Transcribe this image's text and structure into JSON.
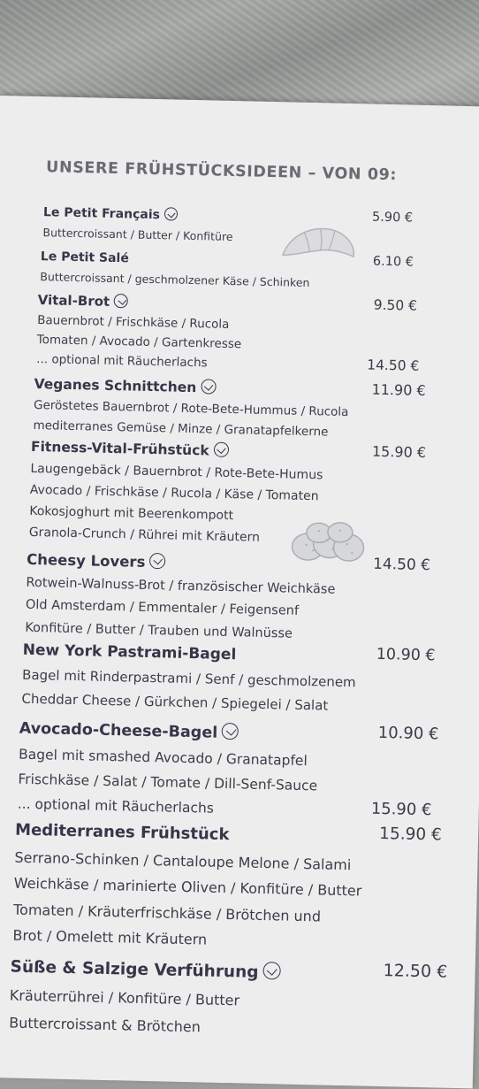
{
  "header": "UNSERE FRÜHSTÜCKSIDEEN – VON 09:",
  "items": [
    {
      "name": "Le Petit Français",
      "vegan_icon": true,
      "price": "5.90 €",
      "lines": [
        "Buttercroissant / Butter / Konfitüre"
      ]
    },
    {
      "name": "Le Petit Salé",
      "vegan_icon": false,
      "price": "6.10 €",
      "lines": [
        "Buttercroissant / geschmolzener Käse / Schinken"
      ]
    },
    {
      "name": "Vital-Brot",
      "vegan_icon": true,
      "price": "9.50 €",
      "lines": [
        "Bauernbrot / Frischkäse / Rucola",
        "Tomaten / Avocado / Gartenkresse",
        "... optional mit Räucherlachs"
      ],
      "extra_price": "14.50 €"
    },
    {
      "name": "Veganes Schnittchen",
      "vegan_icon": true,
      "price": "11.90 €",
      "lines": [
        "Geröstetes Bauernbrot / Rote-Bete-Hummus / Rucola",
        "mediterranes Gemüse / Minze / Granatapfelkerne"
      ]
    },
    {
      "name": "Fitness-Vital-Frühstück",
      "vegan_icon": true,
      "price": "15.90 €",
      "lines": [
        "Laugengebäck / Bauernbrot / Rote-Bete-Humus",
        "Avocado / Frischkäse / Rucola / Käse / Tomaten",
        "Kokosjoghurt mit Beerenkompott",
        "Granola-Crunch / Rührei mit Kräutern"
      ]
    },
    {
      "name": "Cheesy Lovers",
      "vegan_icon": true,
      "price": "14.50 €",
      "lines": [
        "Rotwein-Walnuss-Brot / französischer Weichkäse",
        "Old Amsterdam  / Emmentaler / Feigensenf",
        "Konfitüre / Butter / Trauben und Walnüsse"
      ]
    },
    {
      "name": "New York Pastrami-Bagel",
      "vegan_icon": false,
      "price": "10.90 €",
      "lines": [
        "Bagel mit Rinderpastrami / Senf / geschmolzenem",
        "Cheddar Cheese / Gürkchen / Spiegelei / Salat"
      ]
    },
    {
      "name": "Avocado-Cheese-Bagel",
      "vegan_icon": true,
      "price": "10.90 €",
      "lines": [
        "Bagel mit smashed Avocado / Granatapfel",
        "Frischkäse / Salat / Tomate / Dill-Senf-Sauce",
        "... optional mit Räucherlachs"
      ],
      "extra_price": "15.90 €"
    },
    {
      "name": "Mediterranes Frühstück",
      "vegan_icon": false,
      "price": "15.90 €",
      "lines": [
        "Serrano-Schinken / Cantaloupe Melone / Salami",
        "Weichkäse / marinierte Oliven / Konfitüre / Butter",
        "Tomaten / Kräuterfrischkäse / Brötchen und",
        "Brot / Omelett mit Kräutern"
      ]
    },
    {
      "name": "Süße & Salzige Verführung",
      "vegan_icon": true,
      "price": "12.50 €",
      "lines": [
        "Kräuterrührei / Konfitüre / Butter",
        "Buttercroissant & Brötchen"
      ]
    }
  ],
  "illustrations": [
    "croissant-icon",
    "bread-rolls-icon"
  ]
}
